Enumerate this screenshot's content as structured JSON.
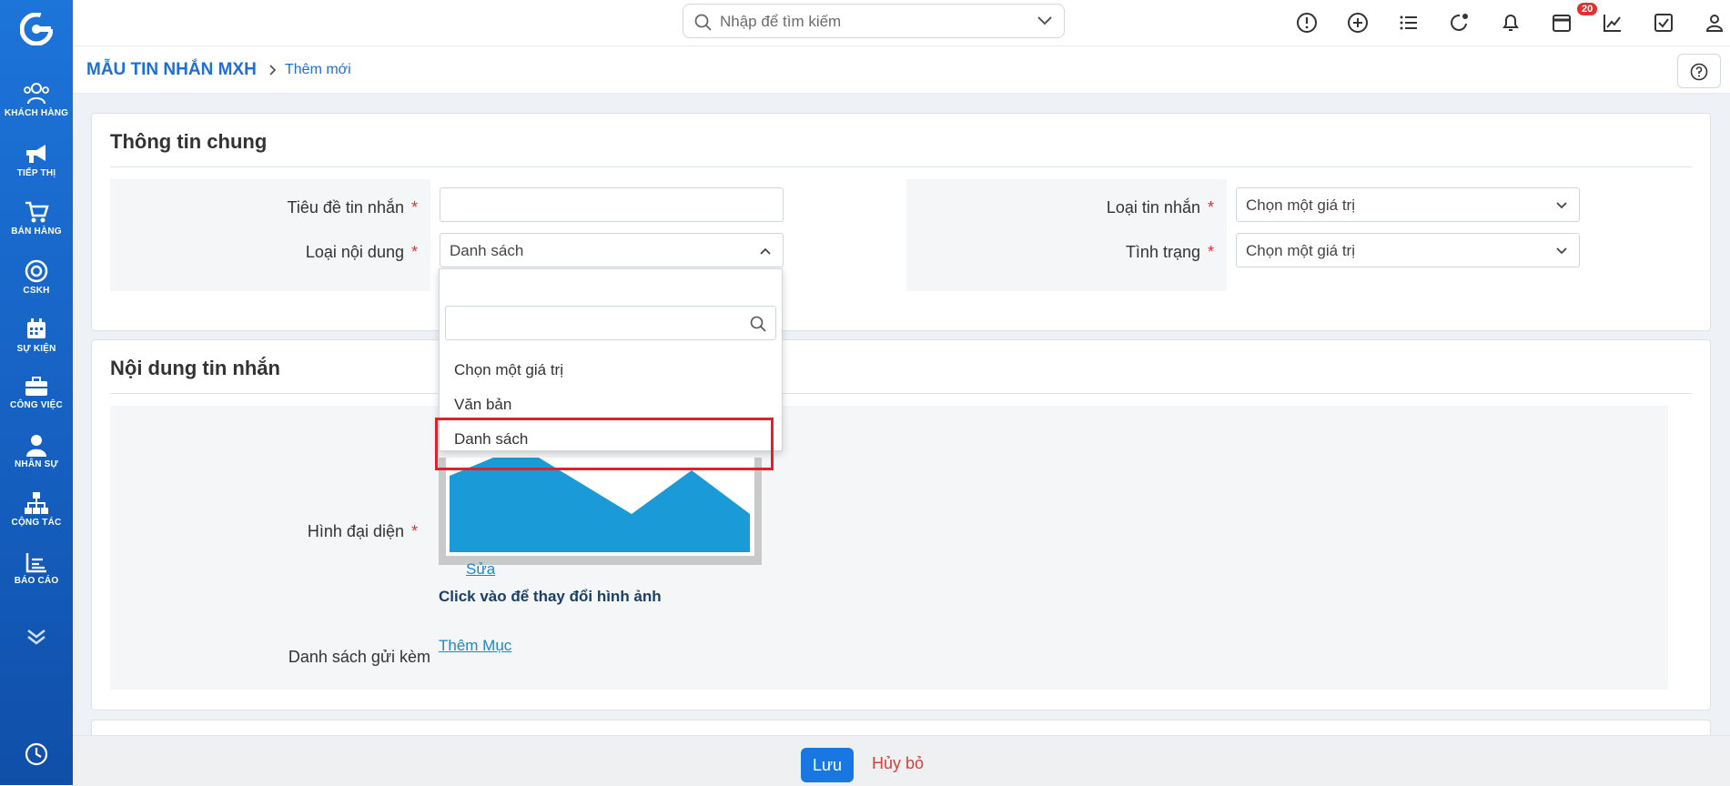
{
  "sidebar": {
    "items": [
      {
        "label": "KHÁCH HÀNG",
        "icon": "customers-icon"
      },
      {
        "label": "TIẾP THỊ",
        "icon": "megaphone-icon"
      },
      {
        "label": "BÁN HÀNG",
        "icon": "cart-icon"
      },
      {
        "label": "CSKH",
        "icon": "lifebuoy-icon"
      },
      {
        "label": "SỰ KIỆN",
        "icon": "calendar-icon"
      },
      {
        "label": "CÔNG VIỆC",
        "icon": "briefcase-icon"
      },
      {
        "label": "NHÂN SỰ",
        "icon": "person-icon"
      },
      {
        "label": "CỘNG TÁC",
        "icon": "org-chart-icon"
      },
      {
        "label": "BÁO CÁO",
        "icon": "report-icon"
      }
    ]
  },
  "header": {
    "search_placeholder": "Nhập để tìm kiếm",
    "notification_count": "20"
  },
  "breadcrumb": {
    "module": "MẪU TIN NHẮN MXH",
    "current": "Thêm mới"
  },
  "general": {
    "title": "Thông tin chung",
    "fields": {
      "title_label": "Tiêu đề tin nhắn",
      "title_value": "",
      "content_type_label": "Loại nội dung",
      "content_type_value": "Danh sách",
      "message_type_label": "Loại tin nhắn",
      "message_type_value": "Chọn một giá trị",
      "status_label": "Tình trạng",
      "status_value": "Chọn một giá trị"
    },
    "required_mark": "*"
  },
  "dropdown": {
    "search_value": "",
    "options": [
      "Chọn một giá trị",
      "Văn bản",
      "Danh sách"
    ],
    "highlighted": "Danh sách"
  },
  "message_content": {
    "title": "Nội dung tin nhắn",
    "avatar_label": "Hình đại diện",
    "edit_link": "Sửa",
    "change_hint": "Click vào để thay đổi hình ảnh",
    "attachments_label": "Danh sách gửi kèm",
    "add_item_link": "Thêm Mục"
  },
  "footer": {
    "save_label": "Lưu",
    "cancel_label": "Hủy bỏ"
  },
  "colors": {
    "sidebar": "#1d74d9",
    "primary": "#1877e0",
    "link": "#1d88c9",
    "danger": "#e0202a",
    "image_fill": "#1a9ad6"
  }
}
